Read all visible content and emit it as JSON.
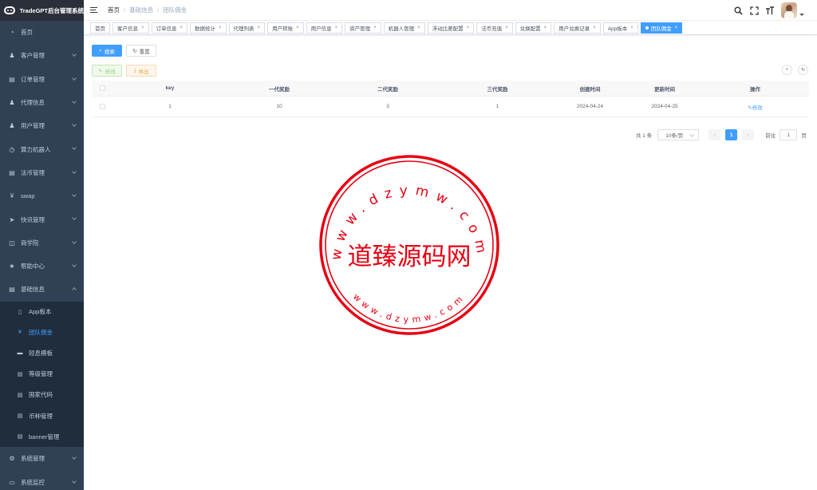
{
  "app": {
    "title": "TradeGPT后台管理系统"
  },
  "sidebar": {
    "items": [
      {
        "label": "首页",
        "icon": "dashboard-icon"
      },
      {
        "label": "客户管理",
        "icon": "user-icon"
      },
      {
        "label": "订单管理",
        "icon": "document-icon"
      },
      {
        "label": "代理信息",
        "icon": "user-icon"
      },
      {
        "label": "用户管理",
        "icon": "user-icon"
      },
      {
        "label": "算力机器人",
        "icon": "clock-icon"
      },
      {
        "label": "法币管理",
        "icon": "document-icon"
      },
      {
        "label": "swap",
        "icon": "yen-icon"
      },
      {
        "label": "快讯管理",
        "icon": "send-icon"
      },
      {
        "label": "商学院",
        "icon": "book-icon"
      },
      {
        "label": "帮助中心",
        "icon": "star-icon"
      },
      {
        "label": "基础信息",
        "icon": "document-icon"
      }
    ],
    "subitems": [
      {
        "label": "App板本",
        "icon": "phone-icon"
      },
      {
        "label": "团队佣金",
        "icon": "yen-icon"
      },
      {
        "label": "短息模板",
        "icon": "message-icon"
      },
      {
        "label": "等级管理",
        "icon": "document-icon"
      },
      {
        "label": "国家代码",
        "icon": "document-icon"
      },
      {
        "label": "币种管理",
        "icon": "document-icon"
      },
      {
        "label": "banner管理",
        "icon": "document-icon"
      }
    ],
    "bottom_items": [
      {
        "label": "系统管理",
        "icon": "gear-icon"
      },
      {
        "label": "系统监控",
        "icon": "monitor-icon"
      }
    ]
  },
  "breadcrumb": [
    "首页",
    "基础信息",
    "团队佣金"
  ],
  "tags": [
    "首页",
    "客户信息",
    "订单信息",
    "数据统计",
    "代理列表",
    "用户转账",
    "用户信息",
    "资产管理",
    "机器人管理",
    "浮动比差配置",
    "法币充值",
    "兑换配置",
    "用户兑换记录",
    "App板本",
    "团队佣金"
  ],
  "toolbar": {
    "search": "搜索",
    "reset": "重置",
    "edit": "修改",
    "export": "导出"
  },
  "table": {
    "headers": [
      "key",
      "一代奖励",
      "二代奖励",
      "三代奖励",
      "创建时间",
      "更新时间",
      "操作"
    ],
    "rows": [
      {
        "key": "1",
        "g1": "10",
        "g2": "3",
        "g3": "1",
        "created": "2024-04-24",
        "updated": "2024-04-25",
        "action": "修改"
      }
    ]
  },
  "pagination": {
    "total": "共 1 条",
    "page_size": "10条/页",
    "current": "1",
    "goto": "前往",
    "goto_value": "1",
    "page_unit": "页"
  },
  "stamp": {
    "text_top": "www.dzymw.com",
    "center": "道臻源码网",
    "text_bottom": "www.dzymw.com",
    "color": "#e60012"
  },
  "colors": {
    "primary": "#409eff",
    "sidebar_bg": "#304156",
    "submenu_bg": "#1f2d3d"
  }
}
